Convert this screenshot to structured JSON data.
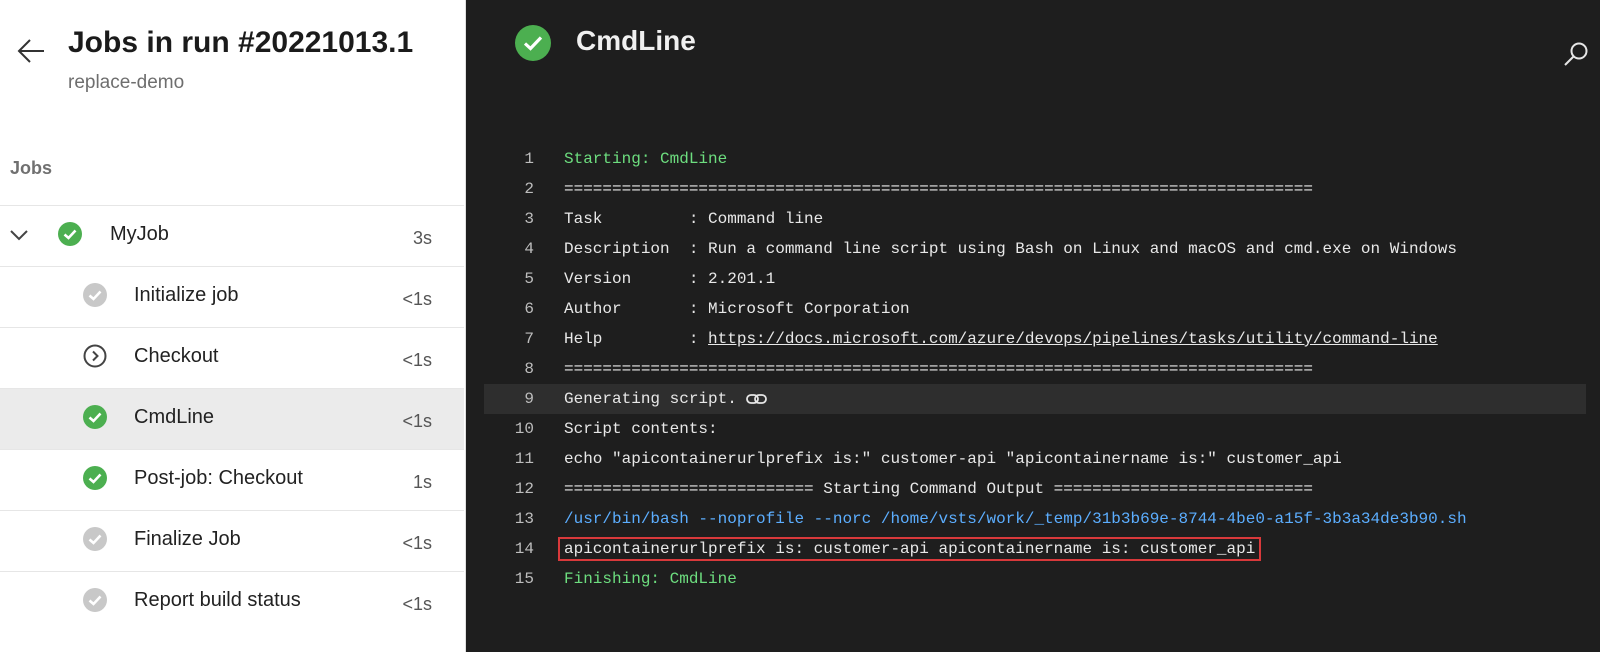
{
  "header": {
    "title": "Jobs in run #20221013.1",
    "subtitle": "replace-demo"
  },
  "jobs_heading": "Jobs",
  "jobs": [
    {
      "name": "MyJob",
      "duration": "3s",
      "status": "succeeded"
    },
    {
      "name": "Initialize job",
      "duration": "<1s",
      "status": "skipped"
    },
    {
      "name": "Checkout",
      "duration": "<1s",
      "status": "in-progress"
    },
    {
      "name": "CmdLine",
      "duration": "<1s",
      "status": "succeeded",
      "selected": true
    },
    {
      "name": "Post-job: Checkout",
      "duration": "1s",
      "status": "succeeded"
    },
    {
      "name": "Finalize Job",
      "duration": "<1s",
      "status": "skipped"
    },
    {
      "name": "Report build status",
      "duration": "<1s",
      "status": "skipped"
    }
  ],
  "log": {
    "title": "CmdLine",
    "lines": [
      {
        "n": "1",
        "text": "Starting: CmdLine"
      },
      {
        "n": "2",
        "text": "=============================================================================="
      },
      {
        "n": "3",
        "text": "Task         : Command line"
      },
      {
        "n": "4",
        "text": "Description  : Run a command line script using Bash on Linux and macOS and cmd.exe on Windows"
      },
      {
        "n": "5",
        "text": "Version      : 2.201.1"
      },
      {
        "n": "6",
        "text": "Author       : Microsoft Corporation"
      },
      {
        "n": "7",
        "text": "Help         : ",
        "link": "https://docs.microsoft.com/azure/devops/pipelines/tasks/utility/command-line"
      },
      {
        "n": "8",
        "text": "=============================================================================="
      },
      {
        "n": "9",
        "text": "Generating script."
      },
      {
        "n": "10",
        "text": "Script contents:"
      },
      {
        "n": "11",
        "text": "echo \"apicontainerurlprefix is:\" customer-api \"apicontainername is:\" customer_api"
      },
      {
        "n": "12",
        "text": "========================== Starting Command Output ==========================="
      },
      {
        "n": "13",
        "text": "/usr/bin/bash --noprofile --norc /home/vsts/work/_temp/31b3b69e-8744-4be0-a15f-3b3a34de3b90.sh"
      },
      {
        "n": "14",
        "text": "apicontainerurlprefix is: customer-api apicontainername is: customer_api"
      },
      {
        "n": "15",
        "text": "Finishing: CmdLine"
      }
    ]
  },
  "colors": {
    "success": "#4caf50",
    "skipped": "#c8c8c8",
    "log_green": "#6dde7f",
    "log_blue": "#5caeff",
    "highlight_box": "#d9393b"
  },
  "icons": {
    "back": "arrow-left-icon",
    "expand": "chevron-down-icon",
    "search": "search-icon",
    "link": "link-icon"
  }
}
